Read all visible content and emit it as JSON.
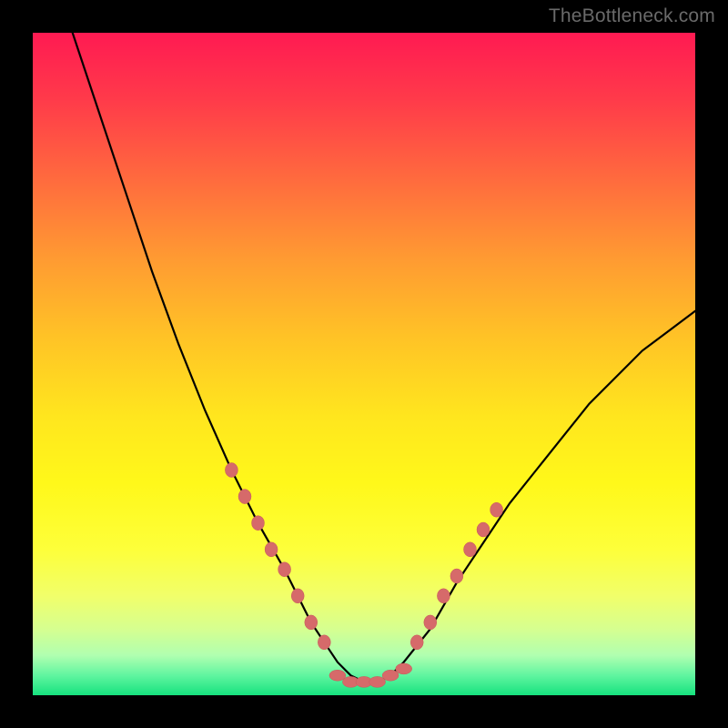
{
  "watermark": "TheBottleneck.com",
  "colors": {
    "background": "#000000",
    "curve": "#000000",
    "marker_fill": "#d66a6a",
    "marker_stroke": "#c75a5a"
  },
  "chart_data": {
    "type": "line",
    "title": "",
    "xlabel": "",
    "ylabel": "",
    "xlim": [
      0,
      100
    ],
    "ylim": [
      0,
      100
    ],
    "grid": false,
    "legend": false,
    "annotations": [
      "TheBottleneck.com"
    ],
    "series": [
      {
        "name": "bottleneck-curve",
        "x": [
          6,
          10,
          14,
          18,
          22,
          26,
          30,
          34,
          38,
          42,
          44,
          46,
          48,
          50,
          52,
          54,
          56,
          60,
          64,
          68,
          72,
          76,
          80,
          84,
          88,
          92,
          96,
          100
        ],
        "y": [
          100,
          88,
          76,
          64,
          53,
          43,
          34,
          26,
          19,
          11,
          8,
          5,
          3,
          2,
          2,
          3,
          5,
          10,
          17,
          23,
          29,
          34,
          39,
          44,
          48,
          52,
          55,
          58
        ]
      }
    ],
    "markers": {
      "left_cluster": [
        {
          "x": 30,
          "y": 34
        },
        {
          "x": 32,
          "y": 30
        },
        {
          "x": 34,
          "y": 26
        },
        {
          "x": 36,
          "y": 22
        },
        {
          "x": 38,
          "y": 19
        },
        {
          "x": 40,
          "y": 15
        },
        {
          "x": 42,
          "y": 11
        },
        {
          "x": 44,
          "y": 8
        }
      ],
      "bottom_cluster": [
        {
          "x": 46,
          "y": 3
        },
        {
          "x": 48,
          "y": 2
        },
        {
          "x": 50,
          "y": 2
        },
        {
          "x": 52,
          "y": 2
        },
        {
          "x": 54,
          "y": 3
        },
        {
          "x": 56,
          "y": 4
        }
      ],
      "right_cluster": [
        {
          "x": 58,
          "y": 8
        },
        {
          "x": 60,
          "y": 11
        },
        {
          "x": 62,
          "y": 15
        },
        {
          "x": 64,
          "y": 18
        },
        {
          "x": 66,
          "y": 22
        },
        {
          "x": 68,
          "y": 25
        },
        {
          "x": 70,
          "y": 28
        }
      ]
    }
  }
}
